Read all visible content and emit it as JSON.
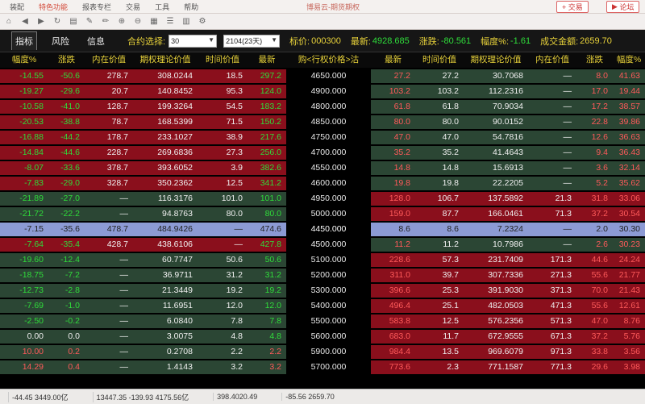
{
  "menu": {
    "items": [
      "装配",
      "特色功能",
      "报表专栏",
      "交易",
      "工具",
      "帮助"
    ],
    "active_index": 1,
    "window_title": "博易云-期货期权",
    "trade_btn": "交易",
    "forum_btn": "论坛"
  },
  "tabs": [
    "指标",
    "风险",
    "信息"
  ],
  "controls": {
    "contract_label": "合约选择:",
    "contract_value": "30",
    "expiry_value": "2104(23天)",
    "underlying_label": "标价:",
    "underlying_value": "000300",
    "last_label": "最新:",
    "last_value": "4928.685",
    "change_label": "涨跌:",
    "change_value": "-80.561",
    "pct_label": "幅度%:",
    "pct_value": "-1.61",
    "turnover_label": "成交金额:",
    "turnover_value": "2659.70"
  },
  "columns": {
    "left": [
      "幅度%",
      "涨跌",
      "内在价值",
      "期权理论价值",
      "时间价值",
      "最新"
    ],
    "strike": "购<行权价格>沽",
    "right": [
      "最新",
      "时间价值",
      "期权理论价值",
      "内在价值",
      "涨跌",
      "幅度%"
    ]
  },
  "rows": [
    {
      "l": [
        "-14.55",
        "-50.6",
        "278.7",
        "308.0244",
        "18.5",
        "297.2"
      ],
      "s": "4650.000",
      "r": [
        "27.2",
        "27.2",
        "30.7068",
        "—",
        "8.0",
        "41.63"
      ]
    },
    {
      "l": [
        "-19.27",
        "-29.6",
        "20.7",
        "140.8452",
        "95.3",
        "124.0"
      ],
      "s": "4900.000",
      "r": [
        "103.2",
        "103.2",
        "112.2316",
        "—",
        "17.0",
        "19.44"
      ]
    },
    {
      "l": [
        "-10.58",
        "-41.0",
        "128.7",
        "199.3264",
        "54.5",
        "183.2"
      ],
      "s": "4800.000",
      "r": [
        "61.8",
        "61.8",
        "70.9034",
        "—",
        "17.2",
        "38.57"
      ]
    },
    {
      "l": [
        "-20.53",
        "-38.8",
        "78.7",
        "168.5399",
        "71.5",
        "150.2"
      ],
      "s": "4850.000",
      "r": [
        "80.0",
        "80.0",
        "90.0152",
        "—",
        "22.8",
        "39.86"
      ]
    },
    {
      "l": [
        "-16.88",
        "-44.2",
        "178.7",
        "233.1027",
        "38.9",
        "217.6"
      ],
      "s": "4750.000",
      "r": [
        "47.0",
        "47.0",
        "54.7816",
        "—",
        "12.6",
        "36.63"
      ]
    },
    {
      "l": [
        "-14.84",
        "-44.6",
        "228.7",
        "269.6836",
        "27.3",
        "256.0"
      ],
      "s": "4700.000",
      "r": [
        "35.2",
        "35.2",
        "41.4643",
        "—",
        "9.4",
        "36.43"
      ]
    },
    {
      "l": [
        "-8.07",
        "-33.6",
        "378.7",
        "393.6052",
        "3.9",
        "382.6"
      ],
      "s": "4550.000",
      "r": [
        "14.8",
        "14.8",
        "15.6913",
        "—",
        "3.6",
        "32.14"
      ]
    },
    {
      "l": [
        "-7.83",
        "-29.0",
        "328.7",
        "350.2362",
        "12.5",
        "341.2"
      ],
      "s": "4600.000",
      "r": [
        "19.8",
        "19.8",
        "22.2205",
        "—",
        "5.2",
        "35.62"
      ]
    },
    {
      "l": [
        "-21.89",
        "-27.0",
        "—",
        "116.3176",
        "101.0",
        "101.0"
      ],
      "s": "4950.000",
      "r": [
        "128.0",
        "106.7",
        "137.5892",
        "21.3",
        "31.8",
        "33.06"
      ]
    },
    {
      "l": [
        "-21.72",
        "-22.2",
        "—",
        "94.8763",
        "80.0",
        "80.0"
      ],
      "s": "5000.000",
      "r": [
        "159.0",
        "87.7",
        "166.0461",
        "71.3",
        "37.2",
        "30.54"
      ]
    },
    {
      "l": [
        "-7.15",
        "-35.6",
        "478.7",
        "484.9426",
        "—",
        "474.6"
      ],
      "s": "4450.000",
      "r": [
        "8.6",
        "8.6",
        "7.2324",
        "—",
        "2.0",
        "30.30"
      ]
    },
    {
      "l": [
        "-7.64",
        "-35.4",
        "428.7",
        "438.6106",
        "—",
        "427.8"
      ],
      "s": "4500.000",
      "r": [
        "11.2",
        "11.2",
        "10.7986",
        "—",
        "2.6",
        "30.23"
      ]
    },
    {
      "l": [
        "-19.60",
        "-12.4",
        "—",
        "60.7747",
        "50.6",
        "50.6"
      ],
      "s": "5100.000",
      "r": [
        "228.6",
        "57.3",
        "231.7409",
        "171.3",
        "44.6",
        "24.24"
      ]
    },
    {
      "l": [
        "-18.75",
        "-7.2",
        "—",
        "36.9711",
        "31.2",
        "31.2"
      ],
      "s": "5200.000",
      "r": [
        "311.0",
        "39.7",
        "307.7336",
        "271.3",
        "55.6",
        "21.77"
      ]
    },
    {
      "l": [
        "-12.73",
        "-2.8",
        "—",
        "21.3449",
        "19.2",
        "19.2"
      ],
      "s": "5300.000",
      "r": [
        "396.6",
        "25.3",
        "391.9030",
        "371.3",
        "70.0",
        "21.43"
      ]
    },
    {
      "l": [
        "-7.69",
        "-1.0",
        "—",
        "11.6951",
        "12.0",
        "12.0"
      ],
      "s": "5400.000",
      "r": [
        "496.4",
        "25.1",
        "482.0503",
        "471.3",
        "55.6",
        "12.61"
      ]
    },
    {
      "l": [
        "-2.50",
        "-0.2",
        "—",
        "6.0840",
        "7.8",
        "7.8"
      ],
      "s": "5500.000",
      "r": [
        "583.8",
        "12.5",
        "576.2356",
        "571.3",
        "47.0",
        "8.76"
      ]
    },
    {
      "l": [
        "0.00",
        "0.0",
        "—",
        "3.0075",
        "4.8",
        "4.8"
      ],
      "s": "5600.000",
      "r": [
        "683.0",
        "11.7",
        "672.9555",
        "671.3",
        "37.2",
        "5.76"
      ]
    },
    {
      "l": [
        "10.00",
        "0.2",
        "—",
        "0.2708",
        "2.2",
        "2.2"
      ],
      "s": "5900.000",
      "r": [
        "984.4",
        "13.5",
        "969.6079",
        "971.3",
        "33.8",
        "3.56"
      ]
    },
    {
      "l": [
        "14.29",
        "0.4",
        "—",
        "1.4143",
        "3.2",
        "3.2"
      ],
      "s": "5700.000",
      "r": [
        "773.6",
        "2.3",
        "771.1587",
        "771.3",
        "29.6",
        "3.98"
      ]
    }
  ],
  "status": [
    "-44.45 3449.00亿",
    "13447.35 -139.93 4175.56亿",
    "398.4020.49",
    "-85.56 2659.70"
  ],
  "colors": {
    "red_bg": "#8a0f1c",
    "green_bg": "#2b4634",
    "highlight": "#8c9ad4",
    "yellow": "#e8d23a",
    "green_text": "#2fdc3a"
  }
}
